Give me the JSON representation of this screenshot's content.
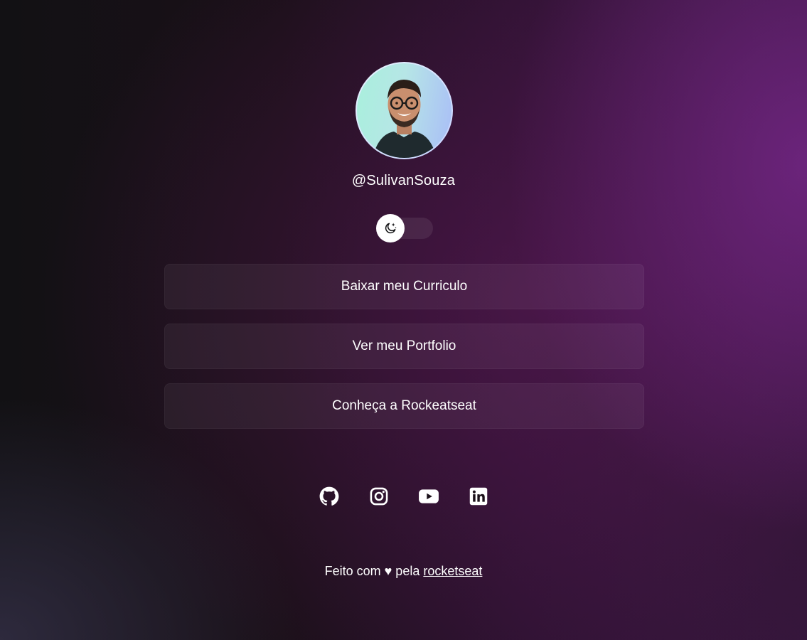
{
  "profile": {
    "username": "@SulivanSouza",
    "avatar_alt": "avatar"
  },
  "theme_switch": {
    "icon": "moon-stars-icon",
    "state": "dark"
  },
  "links": [
    {
      "label": "Baixar meu Curriculo"
    },
    {
      "label": "Ver meu Portfolio"
    },
    {
      "label": "Conheça a Rockeatseat"
    }
  ],
  "socials": [
    {
      "icon": "github-icon"
    },
    {
      "icon": "instagram-icon"
    },
    {
      "icon": "youtube-icon"
    },
    {
      "icon": "linkedin-icon"
    }
  ],
  "footer": {
    "text_before": "Feito com ♥ pela ",
    "link_text": "rocketseat"
  },
  "colors": {
    "text": "#ffffff",
    "accent_purple": "#6e2377",
    "background_dark": "#140f14"
  }
}
